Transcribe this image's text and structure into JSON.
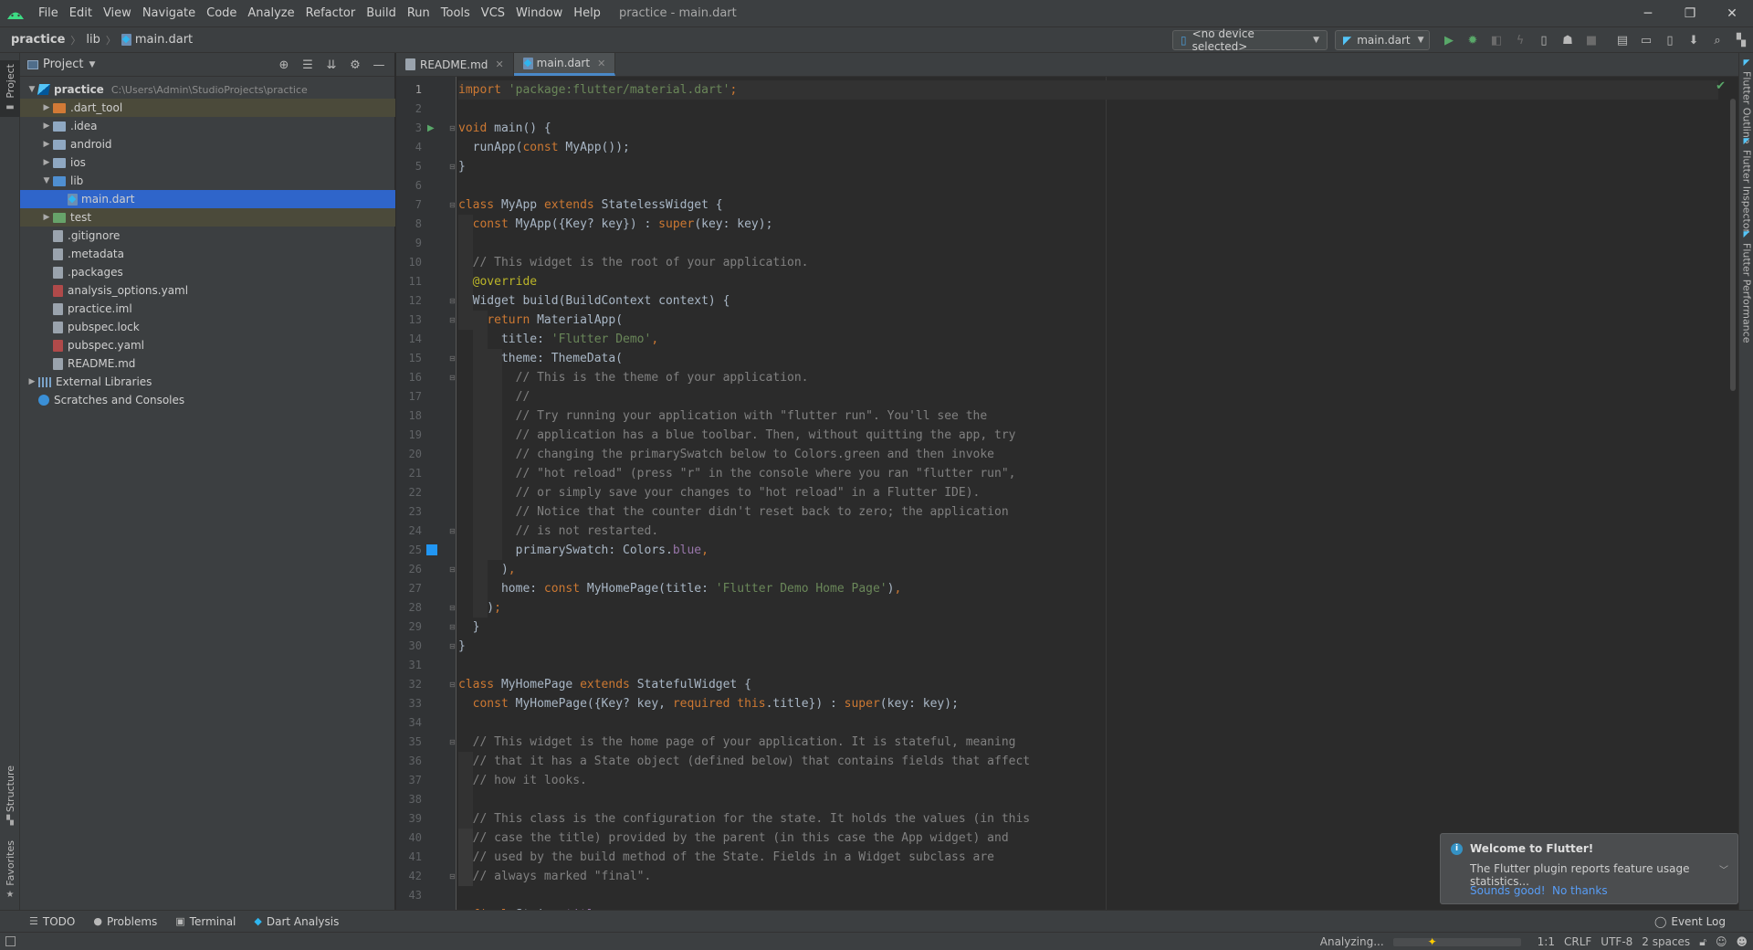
{
  "menubar": {
    "items": [
      "File",
      "Edit",
      "View",
      "Navigate",
      "Code",
      "Analyze",
      "Refactor",
      "Build",
      "Run",
      "Tools",
      "VCS",
      "Window",
      "Help"
    ],
    "window_title": "practice - main.dart",
    "controls": {
      "minimize": "─",
      "restore": "❐",
      "close": "✕"
    }
  },
  "navbar": {
    "breadcrumb": [
      "practice",
      "lib",
      "main.dart"
    ],
    "device_selector": "<no device selected>",
    "run_config": "main.dart"
  },
  "project_panel": {
    "title": "Project",
    "tree": [
      {
        "label": "practice",
        "path": "C:\\Users\\Admin\\StudioProjects\\practice",
        "indent": 0,
        "arrow": "open",
        "icon": "flutter-icon",
        "bold": true
      },
      {
        "label": ".dart_tool",
        "indent": 1,
        "arrow": "closed",
        "icon": "folder-orange-icon",
        "highlight": true
      },
      {
        "label": ".idea",
        "indent": 1,
        "arrow": "closed",
        "icon": "folder-icon"
      },
      {
        "label": "android",
        "indent": 1,
        "arrow": "closed",
        "icon": "folder-icon"
      },
      {
        "label": "ios",
        "indent": 1,
        "arrow": "closed",
        "icon": "folder-icon"
      },
      {
        "label": "lib",
        "indent": 1,
        "arrow": "open",
        "icon": "folder-blue-icon"
      },
      {
        "label": "main.dart",
        "indent": 2,
        "arrow": "none",
        "icon": "dart-file-icon",
        "selected": true
      },
      {
        "label": "test",
        "indent": 1,
        "arrow": "closed",
        "icon": "folder-green-icon",
        "highlight": true
      },
      {
        "label": ".gitignore",
        "indent": 1,
        "arrow": "none",
        "icon": "file-icon"
      },
      {
        "label": ".metadata",
        "indent": 1,
        "arrow": "none",
        "icon": "file-icon"
      },
      {
        "label": ".packages",
        "indent": 1,
        "arrow": "none",
        "icon": "file-icon"
      },
      {
        "label": "analysis_options.yaml",
        "indent": 1,
        "arrow": "none",
        "icon": "yaml-file-icon"
      },
      {
        "label": "practice.iml",
        "indent": 1,
        "arrow": "none",
        "icon": "file-icon"
      },
      {
        "label": "pubspec.lock",
        "indent": 1,
        "arrow": "none",
        "icon": "file-icon"
      },
      {
        "label": "pubspec.yaml",
        "indent": 1,
        "arrow": "none",
        "icon": "yaml-file-icon"
      },
      {
        "label": "README.md",
        "indent": 1,
        "arrow": "none",
        "icon": "md-file-icon"
      },
      {
        "label": "External Libraries",
        "indent": 0,
        "arrow": "closed",
        "icon": "library-icon"
      },
      {
        "label": "Scratches and Consoles",
        "indent": 0,
        "arrow": "none",
        "icon": "scratch-icon"
      }
    ]
  },
  "left_strip": {
    "project": "Project",
    "structure": "Structure",
    "favorites": "Favorites"
  },
  "right_strip": {
    "outline": "Flutter Outline",
    "inspector": "Flutter Inspector",
    "performance": "Flutter Performance"
  },
  "tabs": [
    {
      "label": "README.md",
      "icon": "md-file-icon",
      "active": false
    },
    {
      "label": "main.dart",
      "icon": "dart-file-icon",
      "active": true
    }
  ],
  "editor": {
    "current_line": 1,
    "lines": [
      [
        [
          "k",
          "import "
        ],
        [
          "s",
          "'package:flutter/material.dart'"
        ],
        [
          "k",
          ";"
        ]
      ],
      [],
      [
        [
          "k",
          "void "
        ],
        [
          "tp",
          "main() {"
        ]
      ],
      [
        [
          "tp",
          "  runApp("
        ],
        [
          "k",
          "const "
        ],
        [
          "tp",
          "MyApp());"
        ]
      ],
      [
        [
          "tp",
          "}"
        ]
      ],
      [],
      [
        [
          "k",
          "class "
        ],
        [
          "tp",
          "MyApp "
        ],
        [
          "k",
          "extends "
        ],
        [
          "tp",
          "StatelessWidget {"
        ]
      ],
      [
        [
          "tp",
          "  "
        ],
        [
          "k",
          "const "
        ],
        [
          "tp",
          "MyApp({Key? key}) : "
        ],
        [
          "k",
          "super"
        ],
        [
          "tp",
          "(key: key);"
        ]
      ],
      [],
      [
        [
          "c",
          "  // This widget is the root of your application."
        ]
      ],
      [
        [
          "a",
          "  @override"
        ]
      ],
      [
        [
          "tp",
          "  Widget build(BuildContext context) {"
        ]
      ],
      [
        [
          "tp",
          "    "
        ],
        [
          "k",
          "return "
        ],
        [
          "tp",
          "MaterialApp("
        ]
      ],
      [
        [
          "tp",
          "      title: "
        ],
        [
          "s",
          "'Flutter Demo'"
        ],
        [
          "k",
          ","
        ]
      ],
      [
        [
          "tp",
          "      theme: ThemeData("
        ]
      ],
      [
        [
          "c",
          "        // This is the theme of your application."
        ]
      ],
      [
        [
          "c",
          "        //"
        ]
      ],
      [
        [
          "c",
          "        // Try running your application with \"flutter run\". You'll see the"
        ]
      ],
      [
        [
          "c",
          "        // application has a blue toolbar. Then, without quitting the app, try"
        ]
      ],
      [
        [
          "c",
          "        // changing the primarySwatch below to Colors.green and then invoke"
        ]
      ],
      [
        [
          "c",
          "        // \"hot reload\" (press \"r\" in the console where you ran \"flutter run\","
        ]
      ],
      [
        [
          "c",
          "        // or simply save your changes to \"hot reload\" in a Flutter IDE)."
        ]
      ],
      [
        [
          "c",
          "        // Notice that the counter didn't reset back to zero; the application"
        ]
      ],
      [
        [
          "c",
          "        // is not restarted."
        ]
      ],
      [
        [
          "tp",
          "        primarySwatch: Colors."
        ],
        [
          "n",
          "blue"
        ],
        [
          "k",
          ","
        ]
      ],
      [
        [
          "tp",
          "      )"
        ],
        [
          "k",
          ","
        ]
      ],
      [
        [
          "tp",
          "      home: "
        ],
        [
          "k",
          "const "
        ],
        [
          "tp",
          "MyHomePage(title: "
        ],
        [
          "s",
          "'Flutter Demo Home Page'"
        ],
        [
          "tp",
          ")"
        ],
        [
          "k",
          ","
        ]
      ],
      [
        [
          "tp",
          "    )"
        ],
        [
          "k",
          ";"
        ]
      ],
      [
        [
          "tp",
          "  }"
        ]
      ],
      [
        [
          "tp",
          "}"
        ]
      ],
      [],
      [
        [
          "k",
          "class "
        ],
        [
          "tp",
          "MyHomePage "
        ],
        [
          "k",
          "extends "
        ],
        [
          "tp",
          "StatefulWidget {"
        ]
      ],
      [
        [
          "tp",
          "  "
        ],
        [
          "k",
          "const "
        ],
        [
          "tp",
          "MyHomePage({Key? key, "
        ],
        [
          "k",
          "required this"
        ],
        [
          "tp",
          ".title}) : "
        ],
        [
          "k",
          "super"
        ],
        [
          "tp",
          "(key: key);"
        ]
      ],
      [],
      [
        [
          "c",
          "  // This widget is the home page of your application. It is stateful, meaning"
        ]
      ],
      [
        [
          "c",
          "  // that it has a State object (defined below) that contains fields that affect"
        ]
      ],
      [
        [
          "c",
          "  // how it looks."
        ]
      ],
      [],
      [
        [
          "c",
          "  // This class is the configuration for the state. It holds the values (in this"
        ]
      ],
      [
        [
          "c",
          "  // case the title) provided by the parent (in this case the App widget) and"
        ]
      ],
      [
        [
          "c",
          "  // used by the build method of the State. Fields in a Widget subclass are"
        ]
      ],
      [
        [
          "c",
          "  // always marked \"final\"."
        ]
      ],
      [],
      [
        [
          "tp",
          "  "
        ],
        [
          "k",
          "final "
        ],
        [
          "tp",
          "String "
        ],
        [
          "n",
          "title"
        ],
        [
          "k",
          ";"
        ]
      ]
    ],
    "run_marker_line": 3,
    "color_marker_line": 25,
    "fold_lines": [
      3,
      5,
      7,
      12,
      13,
      15,
      16,
      24,
      26,
      28,
      29,
      30,
      32,
      35,
      42
    ]
  },
  "notification": {
    "title": "Welcome to Flutter!",
    "body": "The Flutter plugin reports feature usage statistics...",
    "accept": "Sounds good!",
    "decline": "No thanks"
  },
  "bottom_tools": {
    "items": [
      {
        "label": "TODO",
        "icon": "list-icon"
      },
      {
        "label": "Problems",
        "icon": "problems-icon"
      },
      {
        "label": "Terminal",
        "icon": "terminal-icon"
      },
      {
        "label": "Dart Analysis",
        "icon": "dart-icon"
      }
    ],
    "event_log": "Event Log"
  },
  "statusbar": {
    "analyzing": "Analyzing...",
    "position": "1:1",
    "line_sep": "CRLF",
    "encoding": "UTF-8",
    "indent": "2 spaces"
  }
}
